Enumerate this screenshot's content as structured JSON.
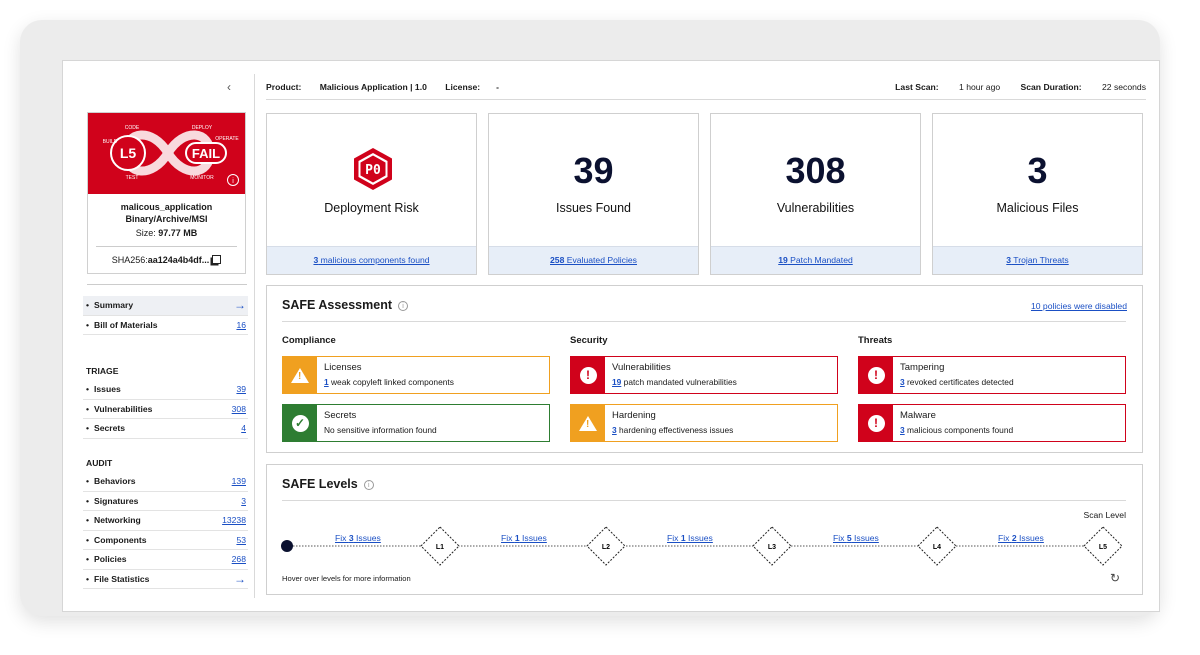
{
  "sidebar": {
    "collapse_icon": "‹",
    "product": {
      "badge_level": "L5",
      "badge_status": "FAIL",
      "banner_words": [
        "CODE",
        "BUILD",
        "TEST",
        "DEPLOY",
        "OPERATE",
        "MONITOR"
      ],
      "name": "malicous_application",
      "type": "Binary/Archive/MSI",
      "size_label": "Size:",
      "size_value": "97.77 MB",
      "sha_label": "SHA256:",
      "sha_value": "aa124a4b4df..."
    },
    "nav_top": [
      {
        "label": "Summary",
        "arrow": "→"
      },
      {
        "label": "Bill of Materials",
        "count": "16"
      }
    ],
    "triage_heading": "TRIAGE",
    "triage": [
      {
        "label": "Issues",
        "count": "39"
      },
      {
        "label": "Vulnerabilities",
        "count": "308"
      },
      {
        "label": "Secrets",
        "count": "4"
      }
    ],
    "audit_heading": "AUDIT",
    "audit": [
      {
        "label": "Behaviors",
        "count": "139"
      },
      {
        "label": "Signatures",
        "count": "3"
      },
      {
        "label": "Networking",
        "count": "13238"
      },
      {
        "label": "Components",
        "count": "53"
      },
      {
        "label": "Policies",
        "count": "268"
      },
      {
        "label": "File Statistics",
        "arrow": "→"
      }
    ]
  },
  "topbar": {
    "product_label": "Product:",
    "product_value": "Malicious Application | 1.0",
    "license_label": "License:",
    "license_value": "-",
    "last_scan_label": "Last Scan:",
    "last_scan_value": "1 hour ago",
    "duration_label": "Scan Duration:",
    "duration_value": "22 seconds"
  },
  "stats": [
    {
      "badge": "P0",
      "caption": "Deployment Risk",
      "foot_num": "3",
      "foot_text": " malicious components found"
    },
    {
      "value": "39",
      "caption": "Issues Found",
      "foot_num": "258",
      "foot_text": " Evaluated Policies"
    },
    {
      "value": "308",
      "caption": "Vulnerabilities",
      "foot_num": "19",
      "foot_text": " Patch Mandated"
    },
    {
      "value": "3",
      "caption": "Malicious Files",
      "foot_num": "3",
      "foot_text": " Trojan Threats"
    }
  ],
  "assessment": {
    "title": "SAFE Assessment",
    "info_icon": "i",
    "disabled_link": "10 policies were disabled",
    "columns": [
      {
        "heading": "Compliance",
        "cards": [
          {
            "title": "Licenses",
            "num": "1",
            "text": " weak copyleft linked components",
            "severity": "warning",
            "color": "#f0a020",
            "icon": "warning-icon"
          },
          {
            "title": "Secrets",
            "num": "",
            "text": "No sensitive information found",
            "severity": "pass",
            "color": "#2e7d32",
            "icon": "check-icon"
          }
        ]
      },
      {
        "heading": "Security",
        "cards": [
          {
            "title": "Vulnerabilities",
            "num": "19",
            "text": " patch mandated vulnerabilities",
            "severity": "fail",
            "color": "#d0021b",
            "icon": "alert-icon"
          },
          {
            "title": "Hardening",
            "num": "3",
            "text": " hardening effectiveness issues",
            "severity": "warning",
            "color": "#f0a020",
            "icon": "warning-icon"
          }
        ]
      },
      {
        "heading": "Threats",
        "cards": [
          {
            "title": "Tampering",
            "num": "3",
            "text": " revoked certificates detected",
            "severity": "fail",
            "color": "#d0021b",
            "icon": "alert-icon"
          },
          {
            "title": "Malware",
            "num": "3",
            "text": " malicious components found",
            "severity": "fail",
            "color": "#d0021b",
            "icon": "alert-icon"
          }
        ]
      }
    ]
  },
  "levels": {
    "title": "SAFE Levels",
    "info_icon": "i",
    "scan_level_label": "Scan Level",
    "nodes": [
      "L1",
      "L2",
      "L3",
      "L4",
      "L5"
    ],
    "fixes": [
      {
        "prefix": "Fix ",
        "num": "3",
        "suffix": " Issues"
      },
      {
        "prefix": "Fix ",
        "num": "1",
        "suffix": " Issues"
      },
      {
        "prefix": "Fix ",
        "num": "1",
        "suffix": " Issues"
      },
      {
        "prefix": "Fix ",
        "num": "5",
        "suffix": " Issues"
      },
      {
        "prefix": "Fix ",
        "num": "2",
        "suffix": " Issues"
      }
    ],
    "hover_note": "Hover over levels for more information",
    "reset_icon": "↻"
  },
  "colors": {
    "fail": "#d0021b",
    "warning": "#f0a020",
    "pass": "#2e7d32",
    "link": "#1a4fc4",
    "navy": "#0b1130"
  }
}
